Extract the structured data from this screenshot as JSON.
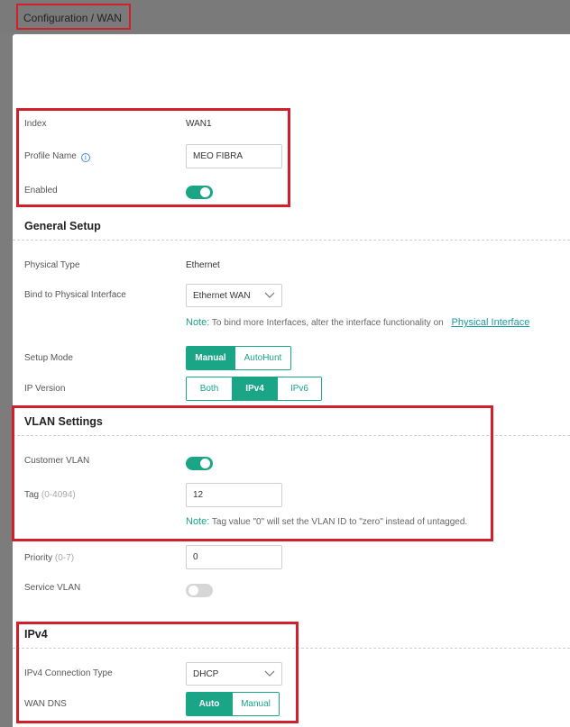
{
  "breadcrumb": "Configuration / WAN",
  "profile": {
    "index_label": "Index",
    "index_value": "WAN1",
    "profile_name_label": "Profile Name",
    "profile_name_value": "MEO FIBRA",
    "enabled_label": "Enabled",
    "enabled": true
  },
  "general_setup": {
    "title": "General Setup",
    "physical_type_label": "Physical Type",
    "physical_type_value": "Ethernet",
    "bind_label": "Bind to Physical Interface",
    "bind_value": "Ethernet WAN",
    "note_key": "Note:",
    "note_text": "To bind more Interfaces, alter the interface functionality on",
    "note_link": "Physical Interface",
    "setup_mode_label": "Setup Mode",
    "setup_mode_options": [
      "Manual",
      "AutoHunt"
    ],
    "setup_mode_selected": "Manual",
    "ip_version_label": "IP Version",
    "ip_version_options": [
      "Both",
      "IPv4",
      "IPv6"
    ],
    "ip_version_selected": "IPv4"
  },
  "vlan": {
    "title": "VLAN Settings",
    "customer_vlan_label": "Customer VLAN",
    "customer_vlan": true,
    "tag_label": "Tag",
    "tag_hint": "(0-4094)",
    "tag_value": "12",
    "note_key": "Note:",
    "note_text": "Tag value \"0\" will set the VLAN ID to \"zero\" instead of untagged.",
    "priority_label": "Priority",
    "priority_hint": "(0-7)",
    "priority_value": "0",
    "service_vlan_label": "Service VLAN",
    "service_vlan": false
  },
  "ipv4": {
    "title": "IPv4",
    "connection_type_label": "IPv4 Connection Type",
    "connection_type_value": "DHCP",
    "wan_dns_label": "WAN DNS",
    "wan_dns_options": [
      "Auto",
      "Manual"
    ],
    "wan_dns_selected": "Auto"
  },
  "colors": {
    "accent": "#1aa587",
    "highlight_box": "#d0202c",
    "link": "#1a9aa0"
  },
  "icons": [
    "info-icon",
    "chevron-down-icon"
  ]
}
